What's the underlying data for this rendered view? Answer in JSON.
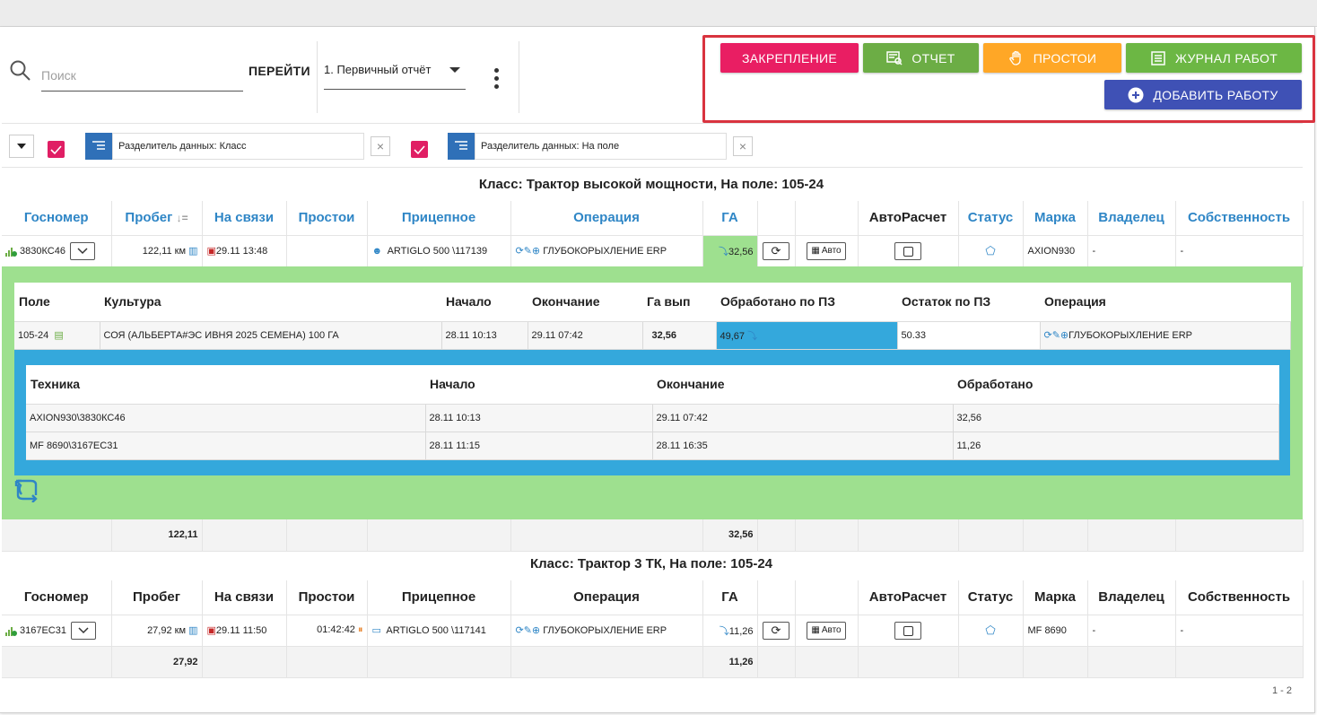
{
  "toolbar": {
    "search_placeholder": "Поиск",
    "goto_label": "ПЕРЕЙТИ",
    "report_selected": "1. Первичный отчёт"
  },
  "actions": {
    "pin_label": "ЗАКРЕПЛЕНИЕ",
    "report_label": "ОТЧЕТ",
    "downtime_label": "ПРОСТОИ",
    "worklog_label": "ЖУРНАЛ РАБОТ",
    "add_work_label": "ДОБАВИТЬ РАБОТУ",
    "colors": {
      "pin": "#e91e63",
      "report": "#6cad45",
      "downtime": "#ffa726",
      "worklog": "#6cb744",
      "add_work": "#3f51b5",
      "highlight": "#d9333f"
    }
  },
  "filters": [
    {
      "label": "Разделитель данных: Класс"
    },
    {
      "label": "Разделитель данных: На поле"
    }
  ],
  "columns": [
    "Госномер",
    "Пробег",
    "На связи",
    "Простои",
    "Прицепное",
    "Операция",
    "ГА",
    "",
    "",
    "АвтоРасчет",
    "Статус",
    "Марка",
    "Владелец",
    "Собственность"
  ],
  "groups": [
    {
      "title": "Класс: Трактор высокой мощности, На поле: 105-24",
      "row": {
        "plate": "3830КС46",
        "mileage": "122,11 км",
        "online": "29.11 13:48",
        "downtime": "",
        "trailer": "ARTIGLO 500 \\117139",
        "operation": "ГЛУБОКОРЫХЛЕНИЕ ERP",
        "ga": "32,56",
        "auto_label": "Авто",
        "brand": "AXION930",
        "owner": "-",
        "property": "-"
      },
      "totals": {
        "mileage": "122,11",
        "ga": "32,56"
      }
    },
    {
      "title": "Класс: Трактор 3 ТК, На поле: 105-24",
      "row": {
        "plate": "3167ЕС31",
        "mileage": "27,92 км",
        "online": "29.11 11:50",
        "downtime": "01:42:42",
        "trailer": "ARTIGLO 500 \\117141",
        "operation": "ГЛУБОКОРЫХЛЕНИЕ ERP",
        "ga": "11,26",
        "auto_label": "Авто",
        "brand": "MF 8690",
        "owner": "-",
        "property": "-"
      },
      "totals": {
        "mileage": "27,92",
        "ga": "11,26"
      }
    }
  ],
  "detail": {
    "columns": [
      "Поле",
      "Культура",
      "Начало",
      "Окончание",
      "Га вып",
      "Обработано по ПЗ",
      "Остаток по ПЗ",
      "Операция"
    ],
    "row": {
      "field": "105-24",
      "crop": "СОЯ (АЛЬБЕРТА#ЭС ИВНЯ 2025 СЕМЕНА) 100 ГА",
      "start": "28.11 10:13",
      "end": "29.11 07:42",
      "ga_done": "32,56",
      "processed": "49,67",
      "remaining": "50.33",
      "operation": "ГЛУБОКОРЫХЛЕНИЕ ERP"
    },
    "machines": {
      "columns": [
        "Техника",
        "Начало",
        "Окончание",
        "Обработано"
      ],
      "rows": [
        {
          "machine": "AXION930\\3830КС46",
          "start": "28.11 10:13",
          "end": "29.11 07:42",
          "done": "32,56"
        },
        {
          "machine": "MF 8690\\3167ЕС31",
          "start": "28.11 11:15",
          "end": "28.11 16:35",
          "done": "11,26"
        }
      ]
    }
  },
  "pager": "1 - 2"
}
